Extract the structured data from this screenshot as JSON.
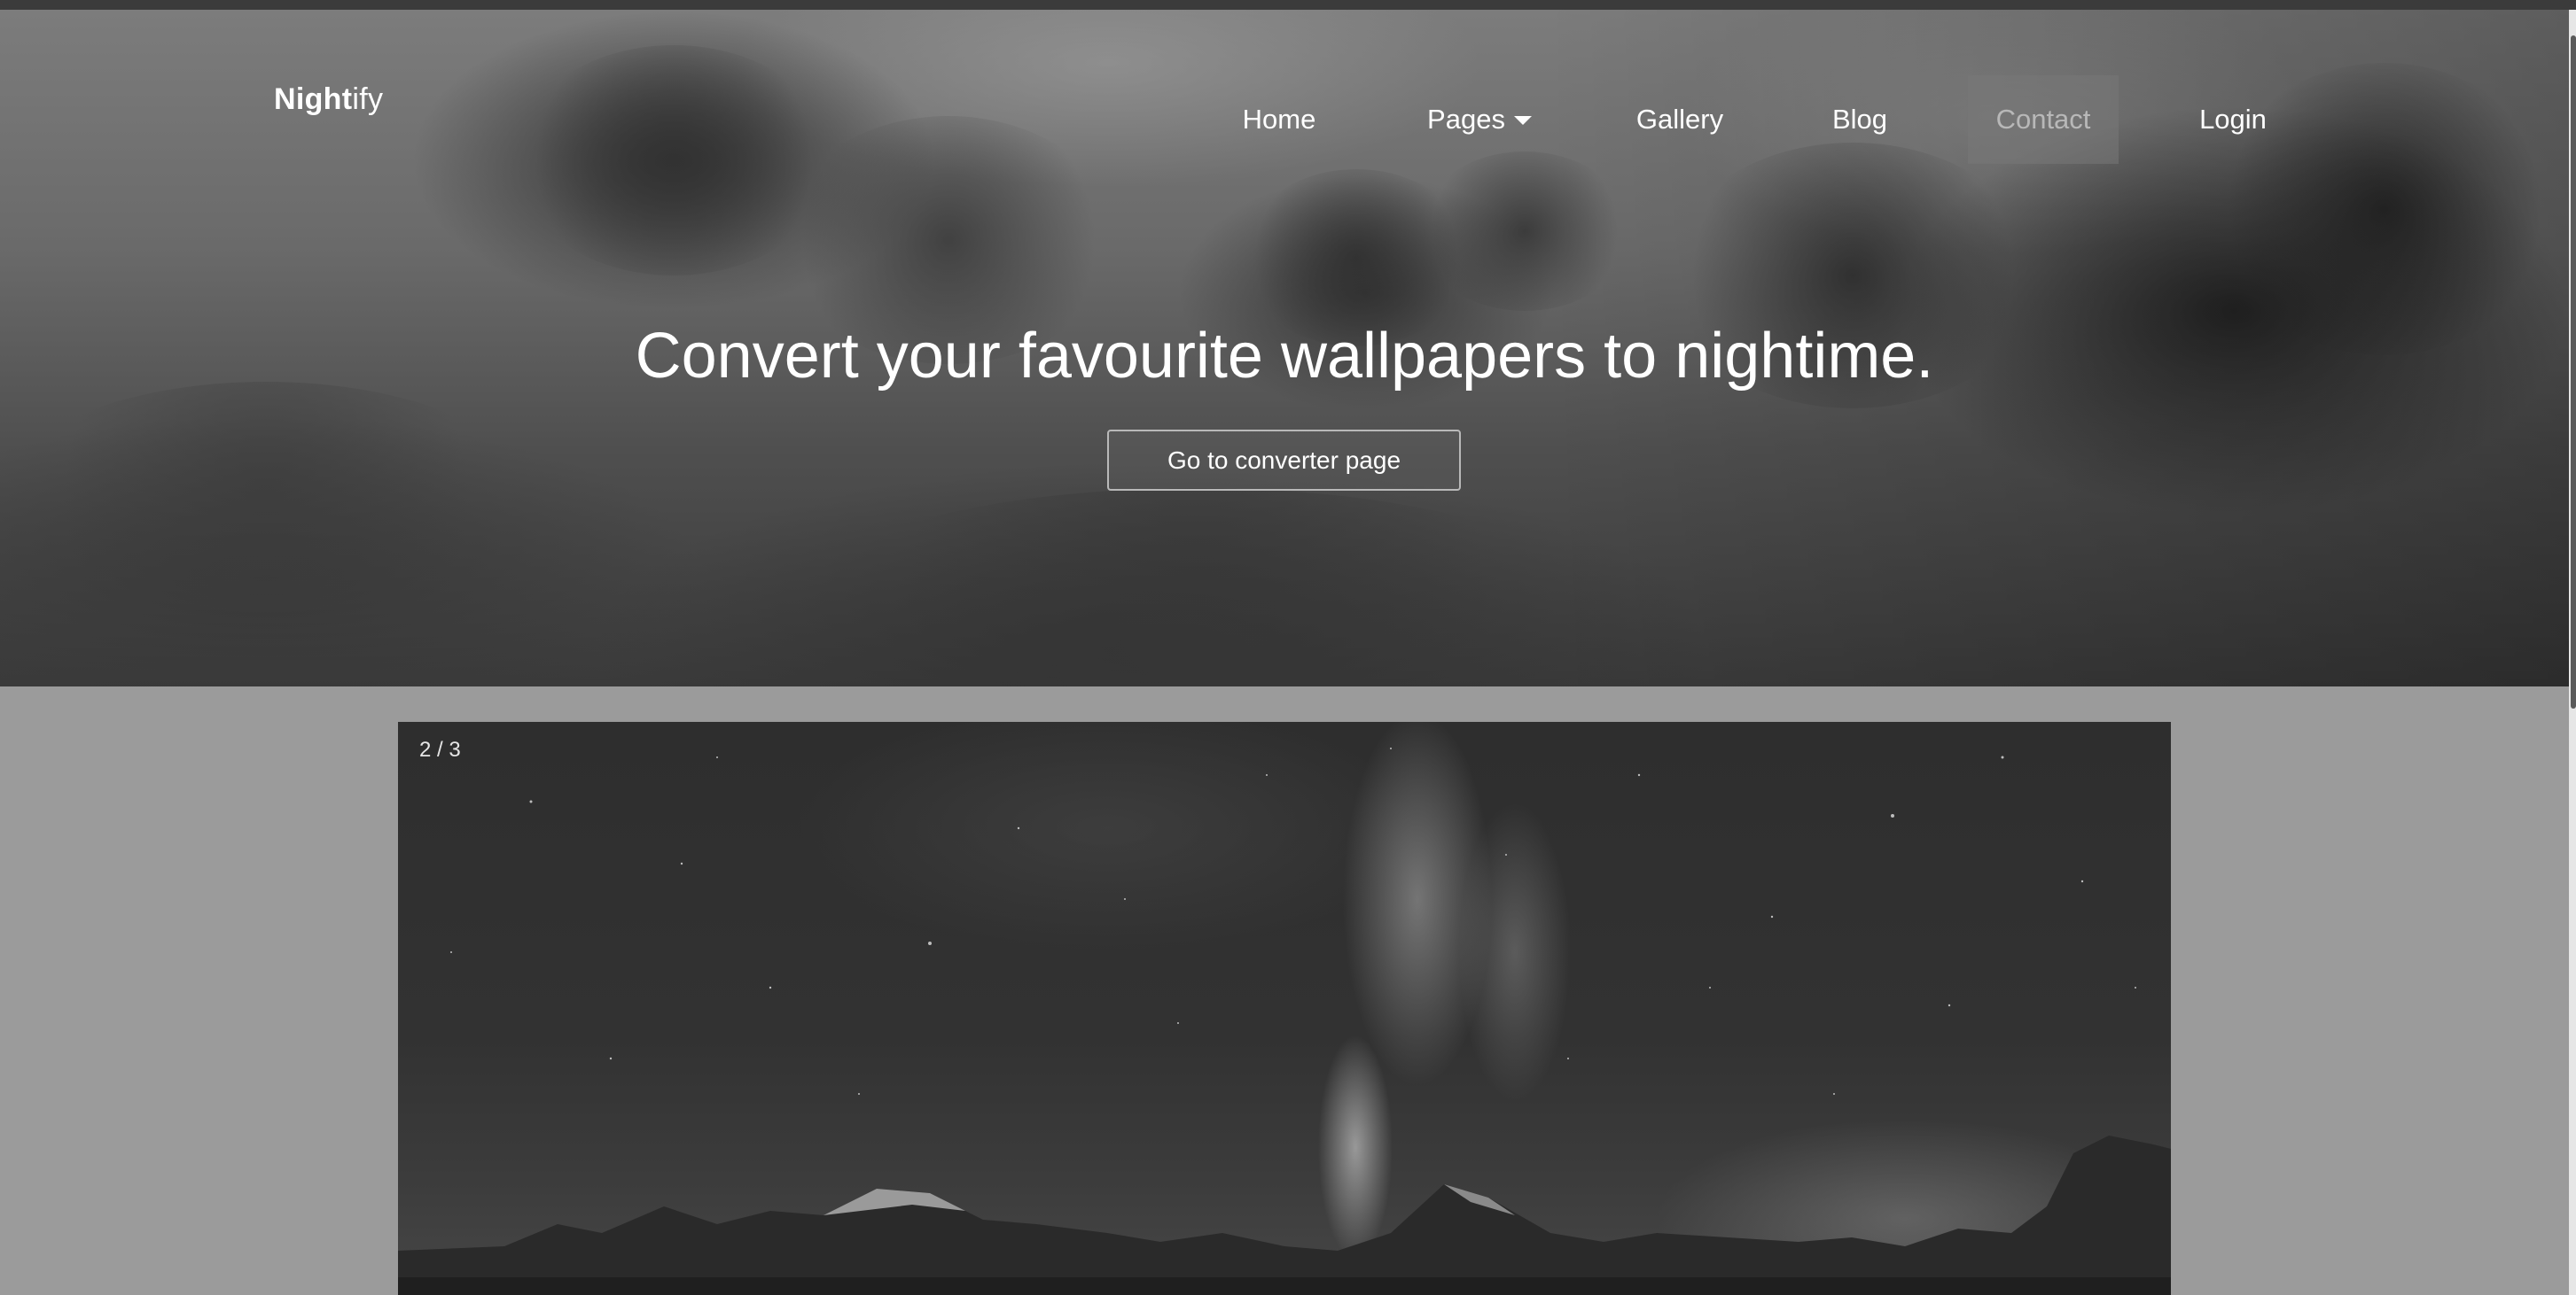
{
  "brand": {
    "bold": "Night",
    "light": "ify"
  },
  "nav": {
    "items": [
      {
        "label": "Home"
      },
      {
        "label": "Pages"
      },
      {
        "label": "Gallery"
      },
      {
        "label": "Blog"
      },
      {
        "label": "Contact",
        "active": true
      },
      {
        "label": "Login"
      }
    ]
  },
  "hero": {
    "title": "Convert your favourite wallpapers to nightime.",
    "cta": "Go to converter page"
  },
  "slideshow": {
    "counter": "2 / 3"
  },
  "colors": {
    "page_bg": "#9b9b9b",
    "topbar": "#3b3b3b",
    "active_nav_bg": "#7a7a7a"
  },
  "icons": {
    "pages_caret": "chevron-down-icon"
  }
}
